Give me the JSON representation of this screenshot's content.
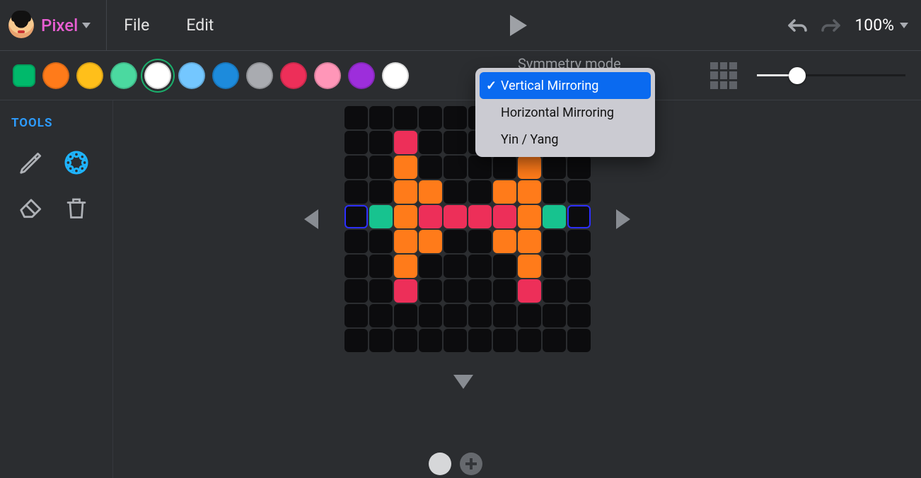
{
  "app": {
    "title": "Pixel",
    "menu": {
      "file": "File",
      "edit": "Edit"
    },
    "zoom": "100%"
  },
  "palette": {
    "selected_index": 0,
    "colors": [
      "#00b96b",
      "#ff7b1a",
      "#ffbf1a",
      "#4bd9a0",
      "#ffffff",
      "#74c7ff",
      "#1d8bdc",
      "#a9abb0",
      "#ed2f59",
      "#ff96b8",
      "#9d2edb",
      "#ffffff"
    ],
    "ring_index": 4
  },
  "symmetry": {
    "label": "Symmetry mode",
    "selected": 0,
    "options": [
      "Vertical Mirroring",
      "Horizontal Mirroring",
      "Yin / Yang"
    ]
  },
  "sidebar": {
    "title": "TOOLS",
    "tools": {
      "pencil": "pencil-icon",
      "pattern": "pattern-icon",
      "eraser": "eraser-icon",
      "trash": "trash-icon",
      "active": "pattern"
    }
  },
  "canvas": {
    "cols": 10,
    "rows": 10,
    "colors": {
      "orange": "#ff7b1a",
      "pink": "#ed2f59",
      "teal": "#17c38f",
      "blueOutline": "#2d2fff"
    },
    "cells": [
      {
        "r": 1,
        "c": 2,
        "fill": "pink"
      },
      {
        "r": 2,
        "c": 2,
        "fill": "orange"
      },
      {
        "r": 2,
        "c": 7,
        "fill": "orange"
      },
      {
        "r": 3,
        "c": 2,
        "fill": "orange"
      },
      {
        "r": 3,
        "c": 3,
        "fill": "orange"
      },
      {
        "r": 3,
        "c": 6,
        "fill": "orange"
      },
      {
        "r": 3,
        "c": 7,
        "fill": "orange"
      },
      {
        "r": 4,
        "c": 0,
        "outline": "blueOutline"
      },
      {
        "r": 4,
        "c": 1,
        "fill": "teal"
      },
      {
        "r": 4,
        "c": 2,
        "fill": "orange"
      },
      {
        "r": 4,
        "c": 3,
        "fill": "pink"
      },
      {
        "r": 4,
        "c": 4,
        "fill": "pink"
      },
      {
        "r": 4,
        "c": 5,
        "fill": "pink"
      },
      {
        "r": 4,
        "c": 6,
        "fill": "pink"
      },
      {
        "r": 4,
        "c": 7,
        "fill": "orange"
      },
      {
        "r": 4,
        "c": 8,
        "fill": "teal"
      },
      {
        "r": 4,
        "c": 9,
        "outline": "blueOutline"
      },
      {
        "r": 5,
        "c": 2,
        "fill": "orange"
      },
      {
        "r": 5,
        "c": 3,
        "fill": "orange"
      },
      {
        "r": 5,
        "c": 6,
        "fill": "orange"
      },
      {
        "r": 5,
        "c": 7,
        "fill": "orange"
      },
      {
        "r": 6,
        "c": 2,
        "fill": "orange"
      },
      {
        "r": 6,
        "c": 7,
        "fill": "orange"
      },
      {
        "r": 7,
        "c": 2,
        "fill": "pink"
      },
      {
        "r": 7,
        "c": 7,
        "fill": "pink"
      }
    ]
  }
}
